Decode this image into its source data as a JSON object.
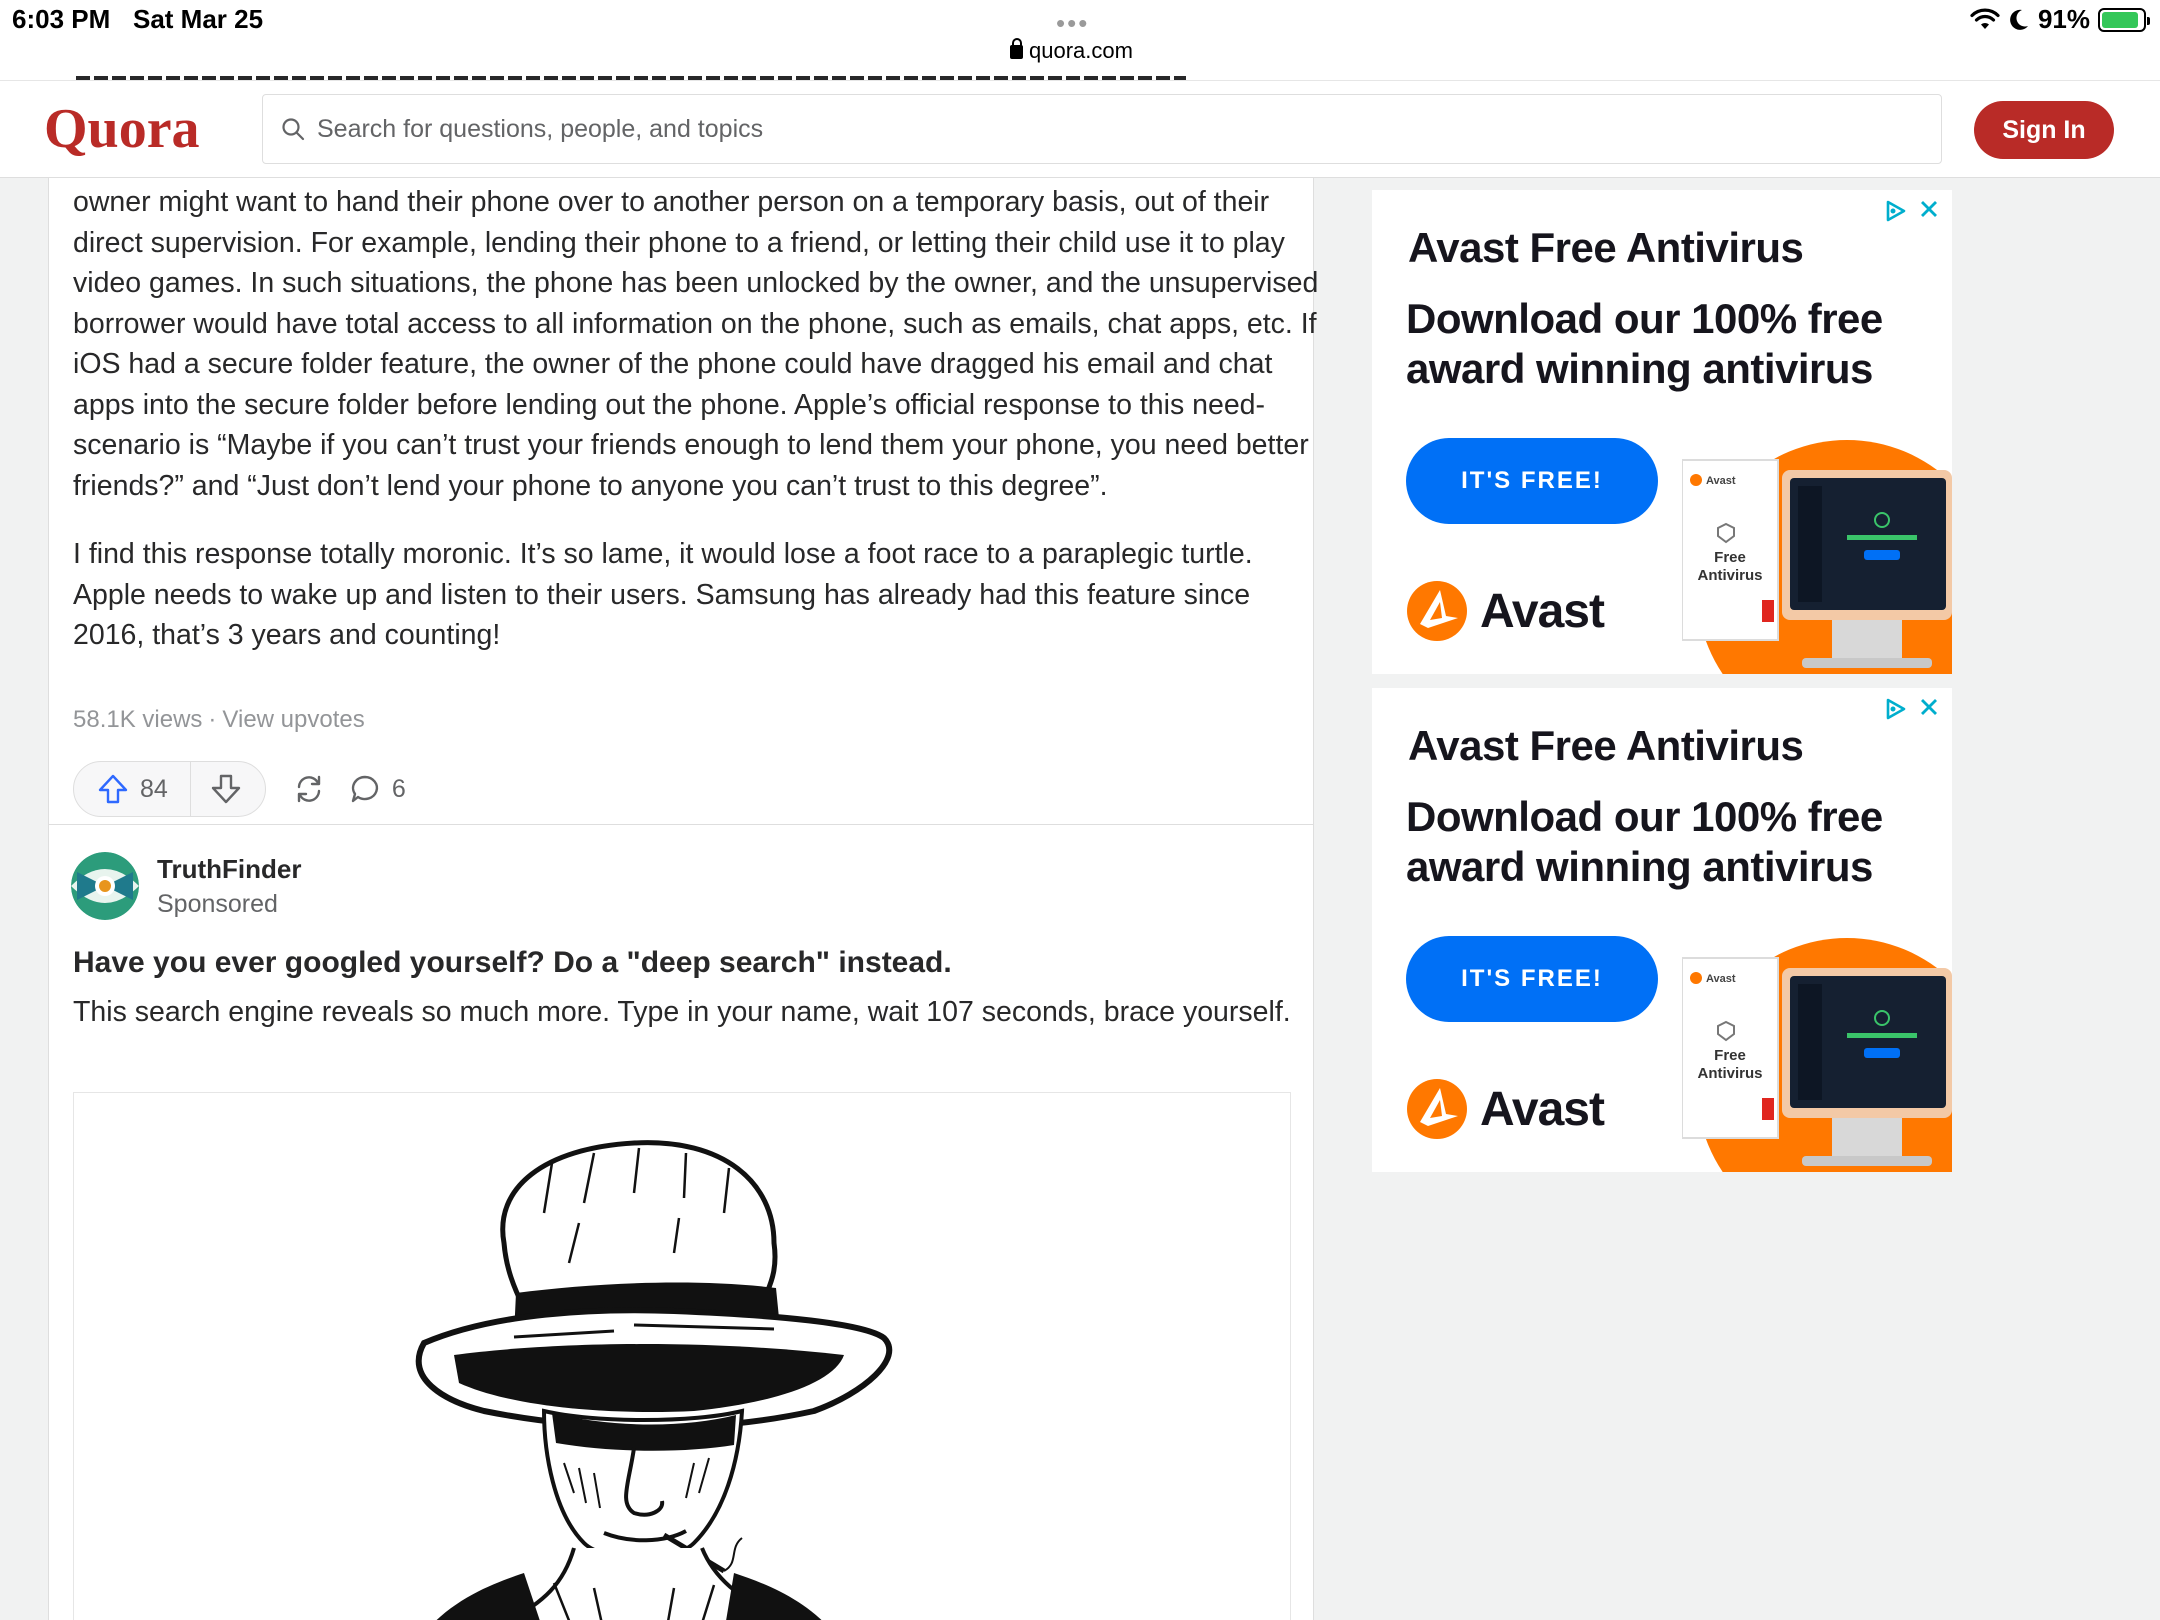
{
  "status_bar": {
    "time": "6:03 PM",
    "date": "Sat Mar 25",
    "dots": "•••",
    "url": "quora.com",
    "battery": "91%",
    "battery_level": 0.91
  },
  "header": {
    "logo": "Quora",
    "search_placeholder": "Search for questions, people, and topics",
    "sign_in": "Sign In"
  },
  "answer": {
    "paragraphs": [
      "owner might want to hand their phone over to another person on a temporary basis, out of their direct supervision. For example, lending their phone to a friend, or letting their child use it to play video games. In such situations, the phone has been unlocked by the owner, and the unsupervised borrower would have total access to all information on the phone, such as emails, chat apps, etc. If iOS had a secure folder feature, the owner of the phone could have dragged his email and chat apps into the secure folder before lending out the phone. Apple’s official response to this need-scenario is “Maybe if you can’t trust your friends enough to lend them your phone, you need better friends?” and “Just don’t lend your phone to anyone you can’t trust to this degree”.",
      "I find this response totally moronic. It’s so lame, it would lose a foot race to a paraplegic turtle. Apple needs to wake up and listen to their users. Samsung has already had this feature since 2016, that’s 3 years and counting!"
    ],
    "views": "58.1K views",
    "separator": "·",
    "view_upvotes": "View upvotes",
    "upvotes": "84",
    "comments": "6"
  },
  "sponsored": {
    "name": "TruthFinder",
    "label": "Sponsored",
    "title": "Have you ever googled yourself? Do a \"deep search\" instead.",
    "body": "This search engine reveals so much more. Type in your name, wait 107 seconds, brace yourself."
  },
  "ads": [
    {
      "title": "Avast Free Antivirus",
      "subtitle": "Download our 100% free award winning antivirus",
      "cta": "IT'S FREE!",
      "brand": "Avast",
      "box_label_1": "Free",
      "box_label_2": "Antivirus",
      "box_brand": "Avast"
    },
    {
      "title": "Avast Free Antivirus",
      "subtitle": "Download our 100% free award winning antivirus",
      "cta": "IT'S FREE!",
      "brand": "Avast",
      "box_label_1": "Free",
      "box_label_2": "Antivirus",
      "box_brand": "Avast"
    }
  ],
  "colors": {
    "brand_red": "#b92b27",
    "upvote_blue": "#2e69ff",
    "ad_blue": "#0070f6",
    "avast_orange": "#ff7800"
  }
}
